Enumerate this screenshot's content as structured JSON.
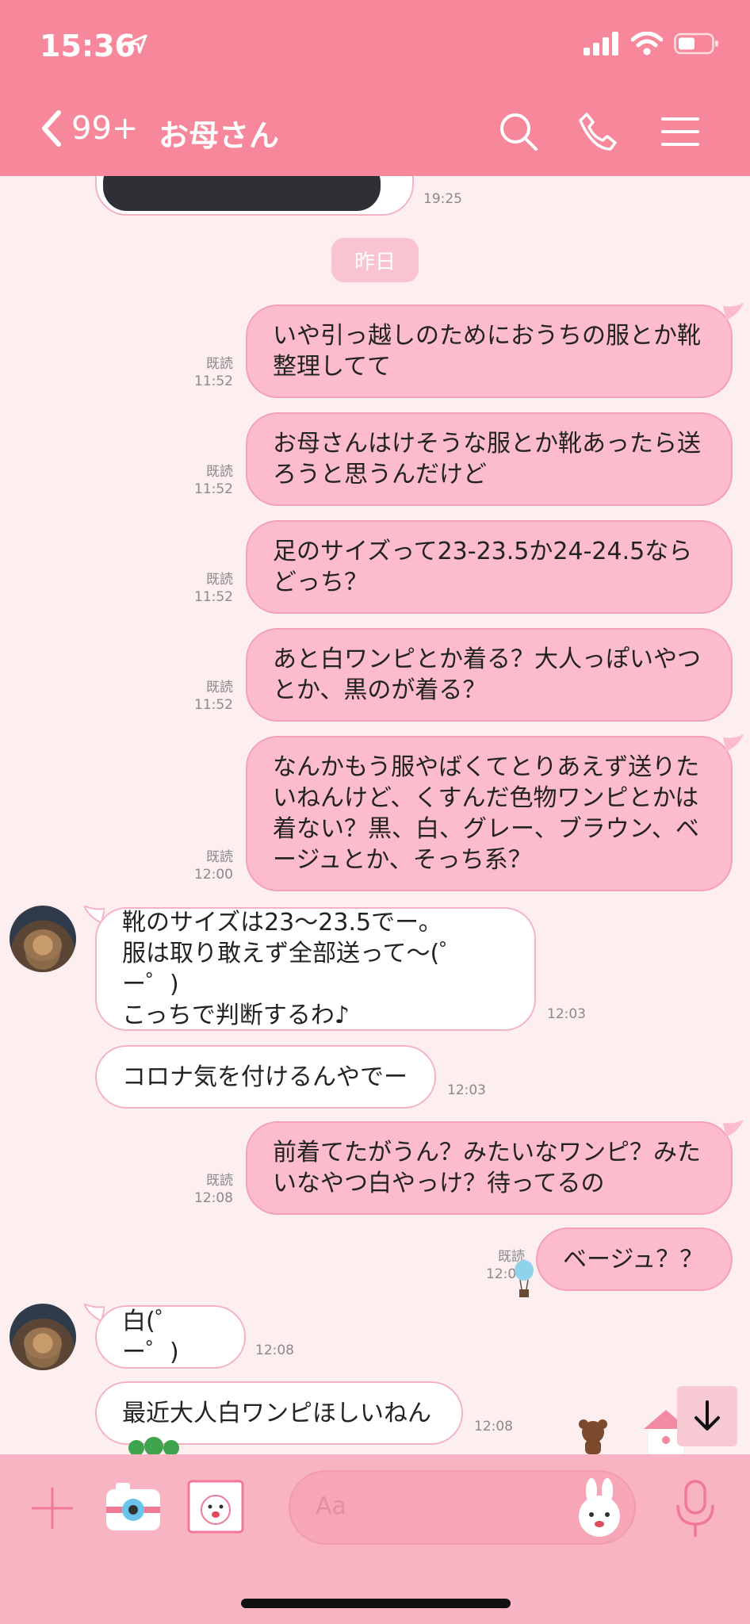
{
  "status": {
    "time": "15:36"
  },
  "header": {
    "back_count": "99+",
    "title": "お母さん"
  },
  "chat": {
    "partial_time": "19:25",
    "date_divider": "昨日",
    "messages": [
      {
        "dir": "out",
        "text": "いや引っ越しのためにおうちの服とか靴\n整理してて",
        "read": "既読",
        "time": "11:52"
      },
      {
        "dir": "out",
        "text": "お母さんはけそうな服とか靴あったら送\nろうと思うんだけど",
        "read": "既読",
        "time": "11:52"
      },
      {
        "dir": "out",
        "text": "足のサイズって23-23.5か24-24.5なら\nどっち？",
        "read": "既読",
        "time": "11:52"
      },
      {
        "dir": "out",
        "text": "あと白ワンピとか着る？大人っぽいやつ\nとか、黒のが着る？",
        "read": "既読",
        "time": "11:52"
      },
      {
        "dir": "out",
        "text": "なんかもう服やばくてとりあえず送りた\nいねんけど、くすんだ色物ワンピとかは\n着ない？黒、白、グレー、ブラウン、ベ\nージュとか、そっち系？",
        "read": "既読",
        "time": "12:00"
      },
      {
        "dir": "in",
        "text": "靴のサイズは23〜23.5でー。\n服は取り敢えず全部送って〜(゜ー゜)\nこっちで判断するわ♪",
        "time": "12:03"
      },
      {
        "dir": "in",
        "text": "コロナ気を付けるんやでー",
        "time": "12:03"
      },
      {
        "dir": "out",
        "text": "前着てたがうん？みたいなワンピ？みた\nいなやつ白やっけ？待ってるの",
        "read": "既読",
        "time": "12:08"
      },
      {
        "dir": "out",
        "text": "ベージュ？？",
        "read": "既読",
        "time": "12:08"
      },
      {
        "dir": "in",
        "text": "白(゜ー゜)",
        "time": "12:08"
      },
      {
        "dir": "in",
        "text": "最近大人白ワンピほしいねん",
        "time": "12:08"
      }
    ]
  },
  "input": {
    "placeholder": "Aa"
  },
  "colors": {
    "header": "#f7889c",
    "bg": "#fdeef0",
    "outgoing": "#fcbccb",
    "incoming": "#ffffff"
  }
}
